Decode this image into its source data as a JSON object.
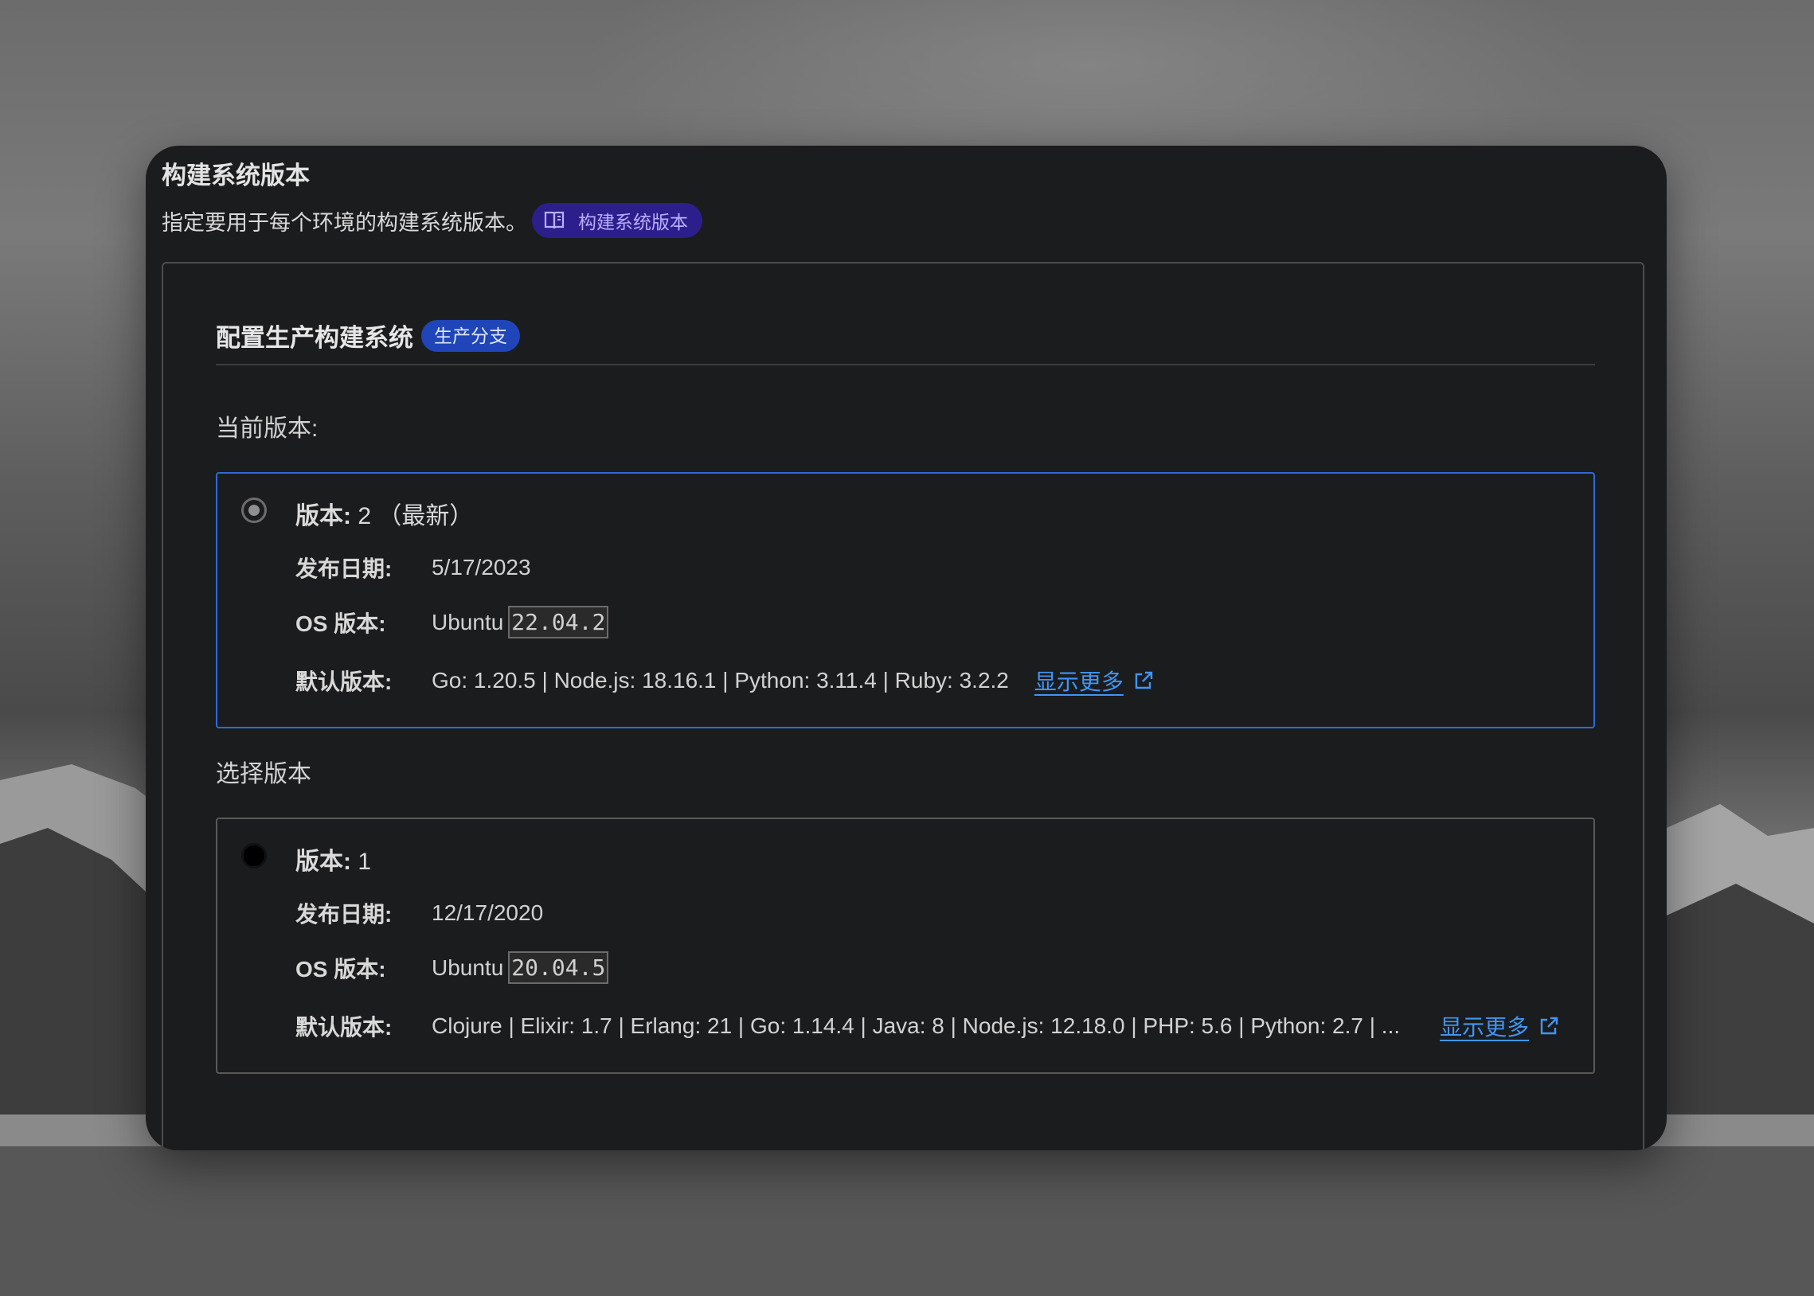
{
  "header": {
    "title": "构建系统版本",
    "description": "指定要用于每个环境的构建系统版本。",
    "docs_link": "构建系统版本"
  },
  "section": {
    "title": "配置生产构建系统",
    "badge": "生产分支"
  },
  "current": {
    "heading": "当前版本:",
    "version_key": "版本:",
    "version_value": "2 （最新）",
    "release_key": "发布日期:",
    "release_value": "5/17/2023",
    "os_key": "OS 版本:",
    "os_name": "Ubuntu",
    "os_version": "22.04.2",
    "defaults_key": "默认版本:",
    "defaults_value": "Go: 1.20.5 | Node.js: 18.16.1 | Python: 3.11.4 | Ruby: 3.2.2",
    "more_label": "显示更多",
    "selected": true
  },
  "choose": {
    "heading": "选择版本",
    "version_key": "版本:",
    "version_value": "1",
    "release_key": "发布日期:",
    "release_value": "12/17/2020",
    "os_key": "OS 版本:",
    "os_name": "Ubuntu",
    "os_version": "20.04.5",
    "defaults_key": "默认版本:",
    "defaults_value": "Clojure | Elixir: 1.7 | Erlang: 21 | Go: 1.14.4 | Java: 8 | Node.js: 12.18.0 | PHP: 5.6 | Python: 2.7 | ...",
    "more_label": "显示更多",
    "selected": false
  },
  "colors": {
    "window_bg": "#1b1c1e",
    "docs_pill_bg": "#2c1f8c",
    "branch_badge_bg": "#1f45b9",
    "selected_border": "#2f6ad6",
    "link": "#3f96f5"
  }
}
